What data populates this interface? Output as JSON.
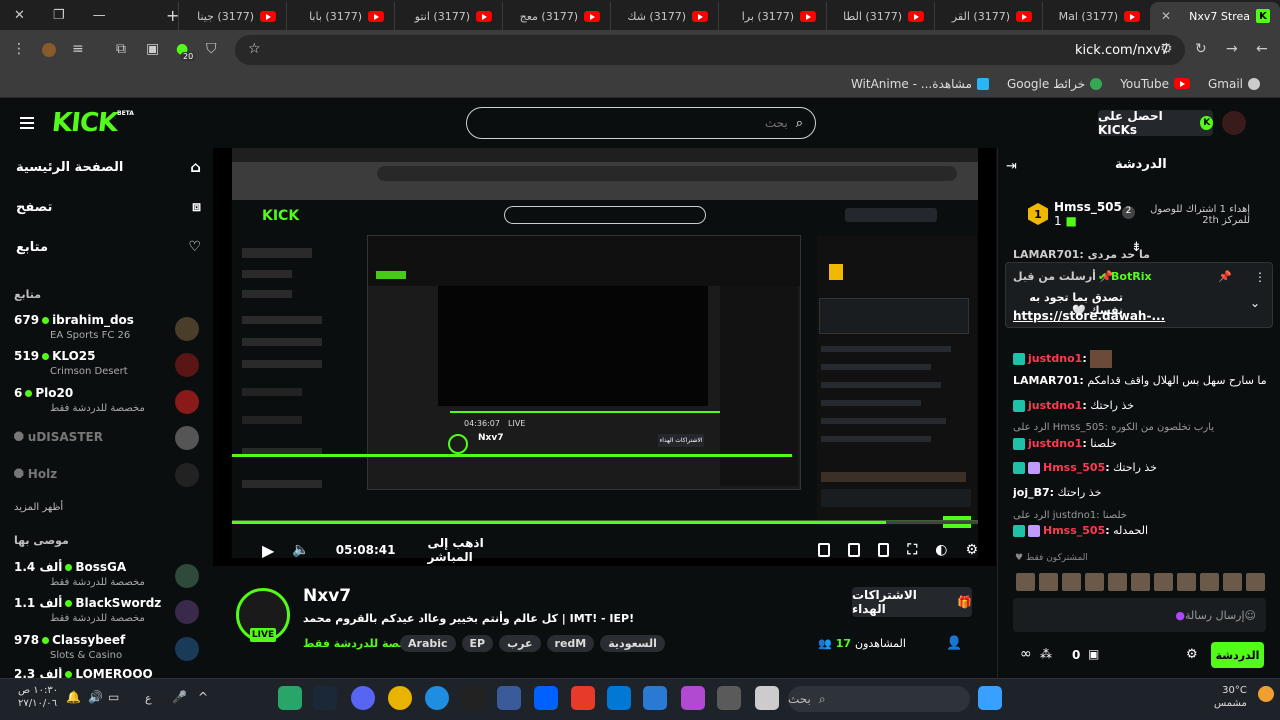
{
  "browser": {
    "tabs": [
      {
        "label": "Nxv7 Strea",
        "active": true,
        "icon": "kick-favicon"
      },
      {
        "label": "(3177) Mal",
        "icon": "youtube-favicon"
      },
      {
        "label": "(3177) القر",
        "icon": "youtube-favicon"
      },
      {
        "label": "(3177) الطا",
        "icon": "youtube-favicon"
      },
      {
        "label": "(3177) برا",
        "icon": "youtube-favicon"
      },
      {
        "label": "(3177) شك",
        "icon": "youtube-favicon"
      },
      {
        "label": "(3177) معج",
        "icon": "youtube-favicon"
      },
      {
        "label": "(3177) انتو",
        "icon": "youtube-favicon"
      },
      {
        "label": "(3177) بابا",
        "icon": "youtube-favicon"
      },
      {
        "label": "(3177) جينا",
        "icon": "youtube-favicon"
      }
    ],
    "url": "kick.com/nxv7",
    "extension_badge": "20",
    "bookmarks": [
      {
        "label": "Gmail"
      },
      {
        "label": "YouTube"
      },
      {
        "label": "خرائط Google"
      },
      {
        "label": "مشاهدة... - WitAnime"
      }
    ]
  },
  "header": {
    "logo": "KICK",
    "beta": "BETA",
    "search_placeholder": "بحث",
    "get_kicks": "احصل على KICKs"
  },
  "sidebar": {
    "nav": [
      {
        "label": "الصفحة الرئيسية",
        "icon": "home-icon"
      },
      {
        "label": "تصفح",
        "icon": "browse-icon"
      },
      {
        "label": "متابع",
        "icon": "heart-icon"
      }
    ],
    "following_title": "متابع",
    "following": [
      {
        "viewers": "679",
        "name": "ibrahim_dos",
        "game": "EA Sports FC 26"
      },
      {
        "viewers": "519",
        "name": "KLO25",
        "game": "Crimson Desert"
      },
      {
        "viewers": "6",
        "name": "Plo20",
        "game": "مخصصة للدردشة فقط"
      }
    ],
    "offline": [
      "uDISASTER",
      "Holz"
    ],
    "show_more": "أظهر المزيد",
    "recommended_title": "موصى بها",
    "recommended": [
      {
        "viewers": "1.4 ألف",
        "name": "BossGA",
        "game": "مخصصة للدردشة فقط"
      },
      {
        "viewers": "1.1 ألف",
        "name": "BlackSwordz",
        "game": "مخصصة للدردشة فقط"
      },
      {
        "viewers": "978",
        "name": "Classybeef",
        "game": "Slots & Casino"
      },
      {
        "viewers": "2.3 ألف",
        "name": "LOMEROOO",
        "game": ""
      }
    ]
  },
  "player": {
    "time": "05:08:41",
    "go_live": "اذهب إلى المباشر",
    "inner_time": "04:36:07",
    "inner_live": "LIVE",
    "inner_streamer": "Nxv7",
    "inner_sub_btn": "الاشتراكات الهداء"
  },
  "stream": {
    "name": "Nxv7",
    "title": "كل عالم وأنتم بخيير وعااد عيدكم بالقروم محمد | IMT! - IEP!",
    "category": "مخصصة للدردشة فقط",
    "tags": [
      "السعودية",
      "redM",
      "عرب",
      "EP",
      "Arabic"
    ],
    "viewers_label": "المشاهدون",
    "viewers_count": "17",
    "subscribe_gift": "الاشتراكات الهداء",
    "live": "LIVE"
  },
  "chat": {
    "title": "الدردشة",
    "leader_name": "Hmss_505",
    "leader_count": "1",
    "leader_rank": "1",
    "goal_text": "إهداء 1 اشتراك للوصول للمركز 2th",
    "goal_rank": "2",
    "pinned_by_label": "أرسلت من قبل",
    "pinned_by": "BotRix",
    "pinned_text": "تصدق بما تجود به نفسك 🤍",
    "pinned_link": "https://store.dawah-...",
    "top_cut": "LAMAR701: ما حد مردي",
    "messages": [
      {
        "user": "justdno1",
        "text": "",
        "color": "red",
        "reply": ""
      },
      {
        "user": "LAMAR701",
        "text": "ركري ما سارح سهل بس الهلال واقف قدامكم",
        "color": "white",
        "reply": ""
      },
      {
        "user": "justdno1",
        "text": "خذ راحتك",
        "color": "red",
        "reply": ""
      },
      {
        "user": "justdno1",
        "text": "خلصنا",
        "color": "red",
        "reply": "الرد على Hmss_505: يارب تخلصون من الكوره"
      },
      {
        "user": "Hmss_505",
        "text": "خذ راحتك",
        "color": "red",
        "reply": ""
      },
      {
        "user": "joj_B7",
        "text": "خذ راحتك",
        "color": "white",
        "reply": ""
      },
      {
        "user": "Hmss_505",
        "text": "الحمدله",
        "color": "red",
        "reply": "الرد على justdno1: خلصنا"
      }
    ],
    "subscribers_only": "المشتركون فقط",
    "input_placeholder": "إرسال رسالة",
    "send": "الدردشة",
    "kicks_count": "0"
  },
  "taskbar": {
    "search": "بحث",
    "time": "١٠:٣٠ ص",
    "date": "٢٧/١٠/٠٦",
    "lang": "ع",
    "temp": "30°C",
    "weather": "مشمس"
  },
  "colors": {
    "accent": "#53fc18",
    "background": "#0b0e0f",
    "red_user": "#ff3a52"
  }
}
